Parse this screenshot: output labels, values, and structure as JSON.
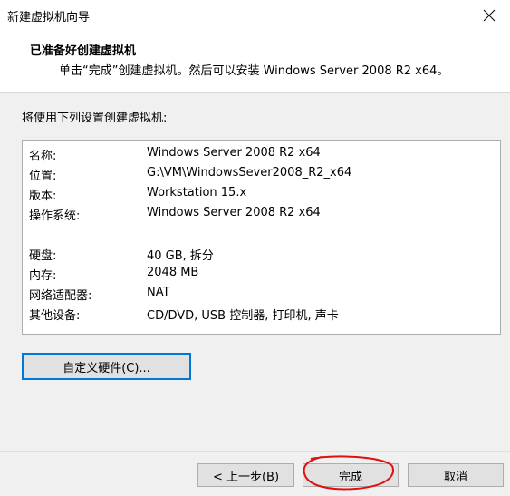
{
  "window": {
    "title": "新建虚拟机向导"
  },
  "header": {
    "title": "已准备好创建虚拟机",
    "subtitle": "单击“完成”创建虚拟机。然后可以安装 Windows Server 2008 R2 x64。"
  },
  "main": {
    "section_label": "将使用下列设置创建虚拟机:",
    "settings": [
      {
        "key": "名称:",
        "value": "Windows Server 2008 R2 x64"
      },
      {
        "key": "位置:",
        "value": "G:\\VM\\WindowsSever2008_R2_x64"
      },
      {
        "key": "版本:",
        "value": "Workstation 15.x"
      },
      {
        "key": "操作系统:",
        "value": "Windows Server 2008 R2 x64"
      },
      {
        "key": "硬盘:",
        "value": "40 GB, 拆分"
      },
      {
        "key": "内存:",
        "value": "2048 MB"
      },
      {
        "key": "网络适配器:",
        "value": "NAT"
      },
      {
        "key": "其他设备:",
        "value": "CD/DVD, USB 控制器, 打印机, 声卡"
      }
    ],
    "customize_button": "自定义硬件(C)..."
  },
  "footer": {
    "back_button": "< 上一步(B)",
    "finish_button": "完成",
    "cancel_button": "取消"
  },
  "colors": {
    "focus_border": "#0078d7",
    "annotation": "#e01010"
  },
  "icons": {
    "close": "close-icon"
  }
}
